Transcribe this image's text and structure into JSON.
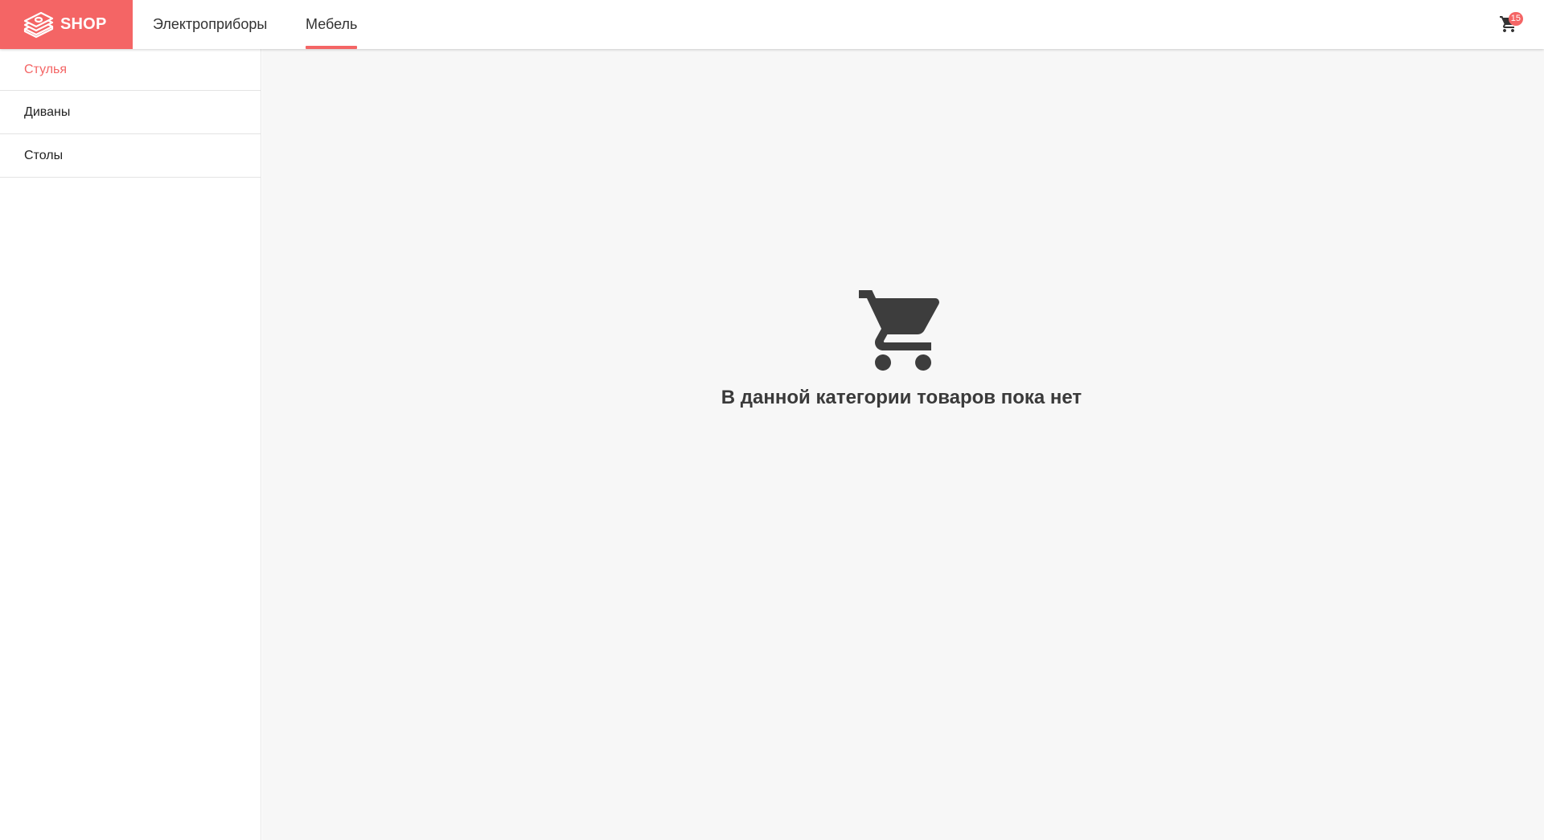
{
  "header": {
    "logo_text": "SHOP",
    "logo_icon": "money-stack-icon",
    "tabs": [
      {
        "label": "Электроприборы",
        "active": false
      },
      {
        "label": "Мебель",
        "active": true
      }
    ],
    "cart": {
      "icon": "cart-icon",
      "badge_count": "15"
    }
  },
  "sidebar": {
    "items": [
      {
        "label": "Стулья",
        "active": true
      },
      {
        "label": "Диваны",
        "active": false
      },
      {
        "label": "Столы",
        "active": false
      }
    ]
  },
  "main": {
    "empty_icon": "cart-icon",
    "empty_message": "В данной категории товаров пока нет"
  },
  "colors": {
    "accent": "#f46565",
    "content_bg": "#f7f7f7",
    "text_dark": "#3a3a3a"
  }
}
